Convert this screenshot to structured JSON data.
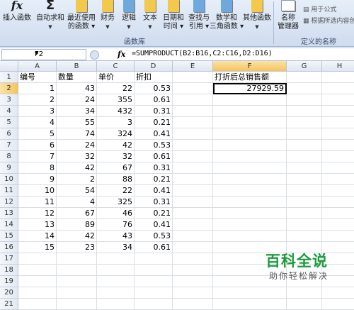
{
  "ribbon": {
    "buttons": [
      {
        "label": "插入函数",
        "icon": "fx-icon"
      },
      {
        "label": "自动求和",
        "icon": "sigma-icon"
      },
      {
        "label": "最近使用的函数",
        "icon": "recent-book-icon"
      },
      {
        "label": "财务",
        "icon": "finance-book-icon"
      },
      {
        "label": "逻辑",
        "icon": "logic-book-icon"
      },
      {
        "label": "文本",
        "icon": "text-book-icon"
      },
      {
        "label": "日期和时间",
        "icon": "date-book-icon"
      },
      {
        "label": "查找与引用",
        "icon": "lookup-book-icon"
      },
      {
        "label": "数学和三角函数",
        "icon": "math-book-icon"
      },
      {
        "label": "其他函数",
        "icon": "other-book-icon"
      },
      {
        "label": "名称管理器",
        "icon": "name-manager-icon"
      }
    ],
    "group_library": "函数库",
    "group_names": "定义的名称",
    "small_cmds": {
      "use_in_formula": "用于公式",
      "create_from_selection": "根据所选内容创"
    }
  },
  "formula_bar": {
    "name_box": "F2",
    "fx": "fx",
    "formula": "=SUMPRODUCT(B2:B16,C2:C16,D2:D16)"
  },
  "grid": {
    "columns": [
      "A",
      "B",
      "C",
      "D",
      "E",
      "F",
      "G",
      "H"
    ],
    "selected_column": "F",
    "selected_row": 2,
    "row_numbers": [
      1,
      2,
      3,
      4,
      5,
      6,
      7,
      8,
      9,
      10,
      11,
      12,
      13,
      14,
      15,
      16,
      17,
      18,
      19,
      20,
      21
    ],
    "headers": {
      "A1": "编号",
      "B1": "数量",
      "C1": "单价",
      "D1": "折扣",
      "F1": "打折后总销售额"
    },
    "rows": [
      [
        "1",
        "43",
        "22",
        "0.53"
      ],
      [
        "2",
        "24",
        "355",
        "0.61"
      ],
      [
        "3",
        "34",
        "432",
        "0.31"
      ],
      [
        "4",
        "55",
        "3",
        "0.21"
      ],
      [
        "5",
        "74",
        "324",
        "0.41"
      ],
      [
        "6",
        "24",
        "42",
        "0.53"
      ],
      [
        "7",
        "32",
        "32",
        "0.61"
      ],
      [
        "8",
        "42",
        "67",
        "0.31"
      ],
      [
        "9",
        "2",
        "88",
        "0.21"
      ],
      [
        "10",
        "54",
        "22",
        "0.41"
      ],
      [
        "11",
        "4",
        "325",
        "0.31"
      ],
      [
        "12",
        "67",
        "46",
        "0.21"
      ],
      [
        "13",
        "89",
        "76",
        "0.41"
      ],
      [
        "14",
        "42",
        "43",
        "0.53"
      ],
      [
        "15",
        "23",
        "34",
        "0.61"
      ]
    ],
    "F2": "27929.59"
  },
  "watermark": {
    "title": "百科全说",
    "subtitle": "助你轻松解决"
  }
}
